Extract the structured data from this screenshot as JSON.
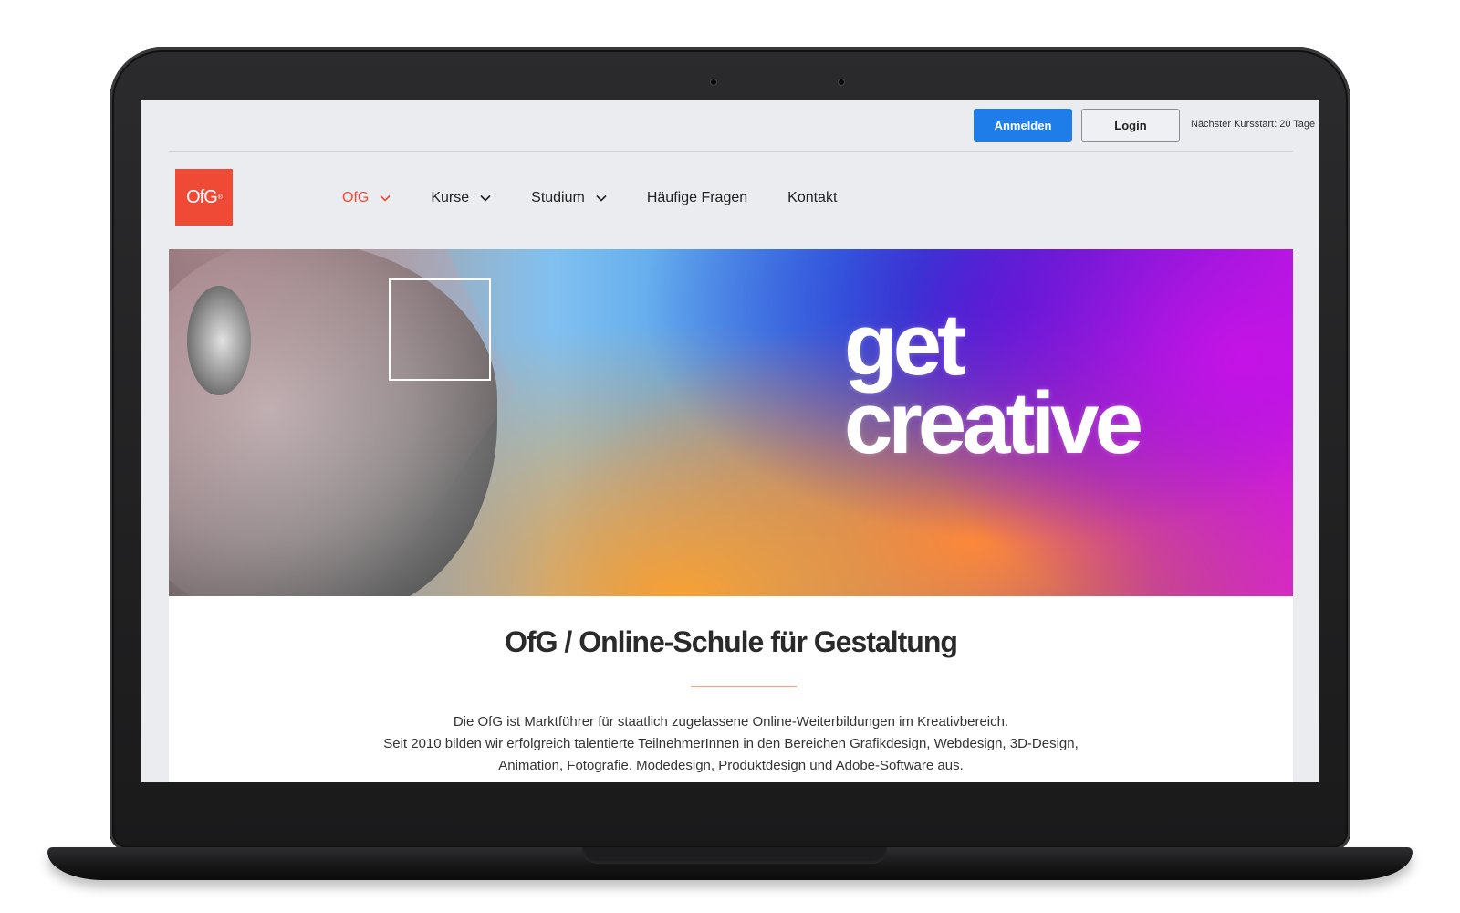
{
  "topbar": {
    "anmelden_label": "Anmelden",
    "login_label": "Login",
    "kursstart_text": "Nächster Kursstart: 20 Tage"
  },
  "logo": {
    "text": "OfG",
    "mark": "®"
  },
  "nav": {
    "items": [
      {
        "label": "OfG",
        "has_dropdown": true,
        "active": true
      },
      {
        "label": "Kurse",
        "has_dropdown": true,
        "active": false
      },
      {
        "label": "Studium",
        "has_dropdown": true,
        "active": false
      },
      {
        "label": "Häufige Fragen",
        "has_dropdown": false,
        "active": false
      },
      {
        "label": "Kontakt",
        "has_dropdown": false,
        "active": false
      }
    ]
  },
  "hero": {
    "line1": "get",
    "line2": "creative"
  },
  "content": {
    "title": "OfG / Online-Schule für Gestaltung",
    "desc_line1": "Die OfG ist Marktführer für staatlich zugelassene Online-Weiterbildungen im Kreativbereich.",
    "desc_line2": "Seit 2010 bilden wir erfolgreich talentierte TeilnehmerInnen in den Bereichen Grafikdesign, Webdesign, 3D-Design,",
    "desc_line3": "Animation, Fotografie, Modedesign, Produktdesign und Adobe-Software aus."
  },
  "colors": {
    "brand": "#ee4a36",
    "primary_button": "#1e7de8",
    "accent_divider": "#f2a58e"
  },
  "icons": {
    "dropdown": "chevron-down-icon"
  }
}
